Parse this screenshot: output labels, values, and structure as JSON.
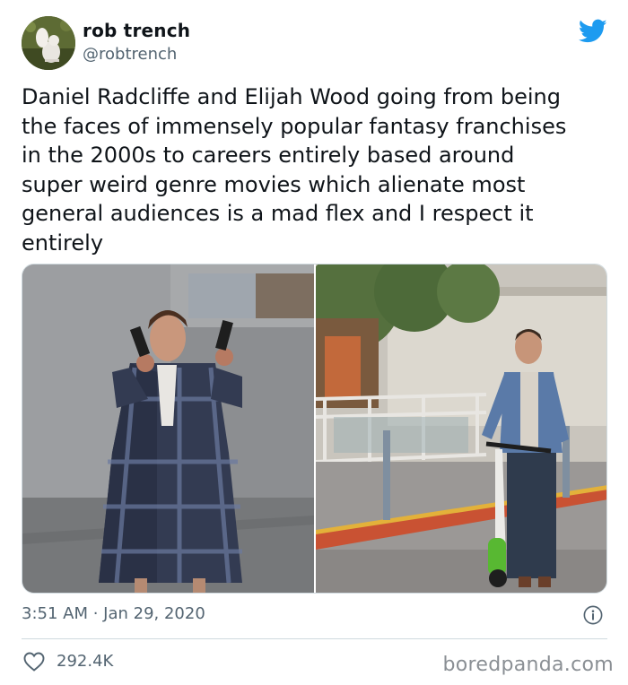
{
  "author": {
    "display_name": "rob trench",
    "handle": "@robtrench"
  },
  "tweet": {
    "text": "Daniel Radcliffe and Elijah Wood going from being\nthe faces of immensely popular fantasy franchises\nin the 2000s to careers entirely based around\nsuper weird genre movies which alienate most\ngeneral audiences is a mad flex and I respect it\nentirely",
    "timestamp": "3:51 AM · Jan 29, 2020",
    "likes": "292.4K"
  },
  "media": {
    "photos": [
      "man-in-plaid-robe-with-pistols",
      "man-in-denim-jacket-on-scooter"
    ]
  },
  "icons": {
    "brand": "twitter-bird-icon",
    "info": "info-icon",
    "like": "heart-icon"
  },
  "colors": {
    "brand_blue": "#1d9bf0",
    "text_primary": "#0f1419",
    "text_secondary": "#536471",
    "border": "#cfd9de"
  },
  "watermark": "boredpanda.com"
}
